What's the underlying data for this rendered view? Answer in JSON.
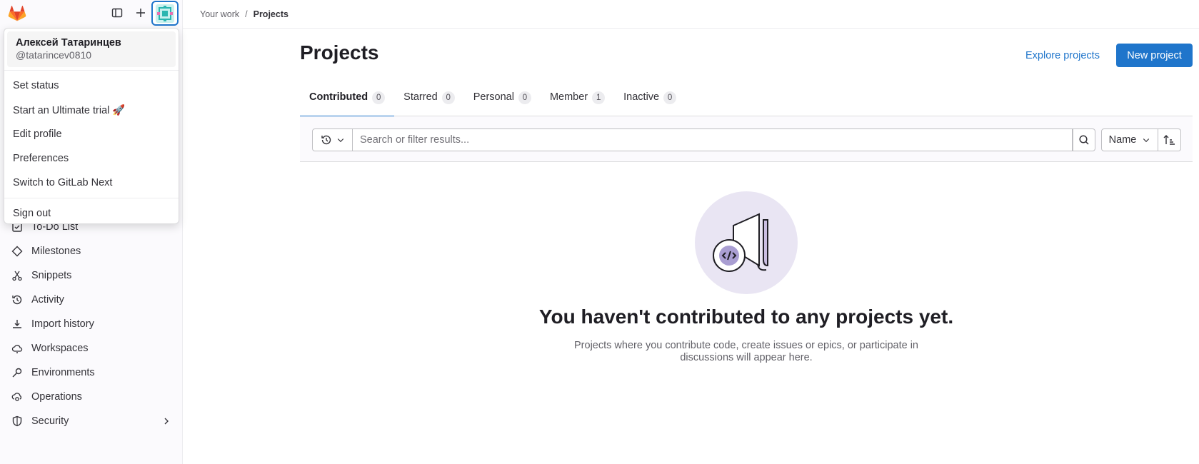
{
  "breadcrumb": {
    "parent": "Your work",
    "separator": "/",
    "current": "Projects"
  },
  "user_menu": {
    "name": "Алексей Татаринцев",
    "handle": "@tatarincev0810",
    "items": [
      "Set status",
      "Start an Ultimate trial 🚀",
      "Edit profile",
      "Preferences",
      "Switch to GitLab Next"
    ],
    "sign_out": "Sign out"
  },
  "sidebar": {
    "items": [
      {
        "label": "To-Do List",
        "icon": "todo-icon"
      },
      {
        "label": "Milestones",
        "icon": "milestone-icon"
      },
      {
        "label": "Snippets",
        "icon": "snippet-icon"
      },
      {
        "label": "Activity",
        "icon": "history-icon"
      },
      {
        "label": "Import history",
        "icon": "import-icon"
      },
      {
        "label": "Workspaces",
        "icon": "cloud-icon"
      },
      {
        "label": "Environments",
        "icon": "environment-icon"
      },
      {
        "label": "Operations",
        "icon": "operations-icon"
      },
      {
        "label": "Security",
        "icon": "shield-icon"
      }
    ]
  },
  "page": {
    "title": "Projects",
    "explore_label": "Explore projects",
    "new_project_label": "New project"
  },
  "tabs": [
    {
      "label": "Contributed",
      "count": "0",
      "active": true
    },
    {
      "label": "Starred",
      "count": "0"
    },
    {
      "label": "Personal",
      "count": "0"
    },
    {
      "label": "Member",
      "count": "1"
    },
    {
      "label": "Inactive",
      "count": "0"
    }
  ],
  "filter": {
    "placeholder": "Search or filter results...",
    "sort_label": "Name"
  },
  "empty_state": {
    "title": "You haven't contributed to any projects yet.",
    "description": "Projects where you contribute code, create issues or epics, or participate in discussions will appear here."
  },
  "colors": {
    "accent": "#1f75cb",
    "illustration_bg": "#e9e5f3",
    "illustration_accent": "#a99ed2"
  }
}
